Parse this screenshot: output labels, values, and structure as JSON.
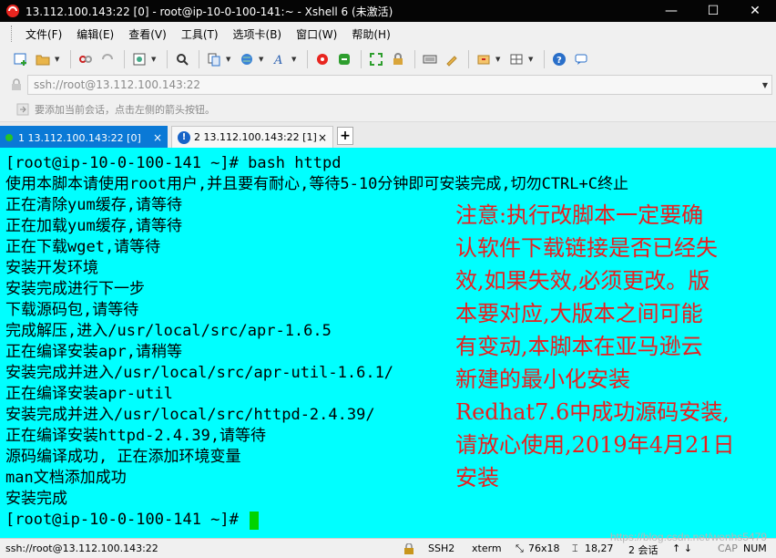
{
  "window": {
    "title": "13.112.100.143:22 [0] - root@ip-10-0-100-141:~ - Xshell 6 (未激活)",
    "minimize_glyph": "—",
    "maximize_glyph": "☐",
    "close_glyph": "✕"
  },
  "menubar": {
    "items": [
      "文件(F)",
      "编辑(E)",
      "查看(V)",
      "工具(T)",
      "选项卡(B)",
      "窗口(W)",
      "帮助(H)"
    ]
  },
  "toolbar": {
    "icons": [
      "new-session-icon",
      "open-folder-icon",
      "disconnect-icon",
      "reconnect-icon",
      "properties-icon",
      "find-icon",
      "copy-paste-icon",
      "globe-icon",
      "font-icon",
      "xshell-icon",
      "xftp-icon",
      "fullscreen-icon",
      "lock-icon",
      "keyboard-icon",
      "highlight-icon",
      "compose-icon",
      "layout-icon",
      "help-icon",
      "chat-icon"
    ]
  },
  "addressbar": {
    "value": "ssh://root@13.112.100.143:22"
  },
  "hintbar": {
    "text": "要添加当前会话，点击左侧的箭头按钮。"
  },
  "tabs": [
    {
      "label": "1 13.112.100.143:22 [0]",
      "active": true,
      "status": "connected"
    },
    {
      "label": "2 13.112.100.143:22 [1]",
      "active": false,
      "status": "warning"
    }
  ],
  "tab_add_label": "+",
  "terminal": {
    "background": "#00ffff",
    "lines": [
      "[root@ip-10-0-100-141 ~]# bash httpd",
      "使用本脚本请使用root用户,并且要有耐心,等待5-10分钟即可安装完成,切勿CTRL+C终止",
      "正在清除yum缓存,请等待",
      "正在加载yum缓存,请等待",
      "正在下载wget,请等待",
      "安装开发环境",
      "安装完成进行下一步",
      "下载源码包,请等待",
      "完成解压,进入/usr/local/src/apr-1.6.5",
      "正在编译安装apr,请稍等",
      "安装完成并进入/usr/local/src/apr-util-1.6.1/",
      "正在编译安装apr-util",
      "安装完成并进入/usr/local/src/httpd-2.4.39/",
      "正在编译安装httpd-2.4.39,请等待",
      "源码编译成功, 正在添加环境变量",
      "man文档添加成功",
      "安装完成"
    ],
    "prompt": "[root@ip-10-0-100-141 ~]# ",
    "note_lines": [
      "注意:执行改脚本一定要确",
      "认软件下载链接是否已经失",
      "效,如果失效,必须更改。版",
      "本要对应,大版本之间可能",
      "有变动,本脚本在亚马逊云",
      "新建的最小化安装",
      "Redhat7.6中成功源码安装,",
      "请放心使用,2019年4月21日",
      "安装"
    ],
    "note_color": "#e8201f"
  },
  "statusbar": {
    "address": "ssh://root@13.112.100.143:22",
    "protocol": "SSH2",
    "terminal_type": "xterm",
    "size": "76x18",
    "position": "18,27",
    "sessions": "2 会话",
    "cap": "CAP",
    "num": "NUM"
  },
  "watermark": "https://blog.csdn.net/wenhs5479"
}
